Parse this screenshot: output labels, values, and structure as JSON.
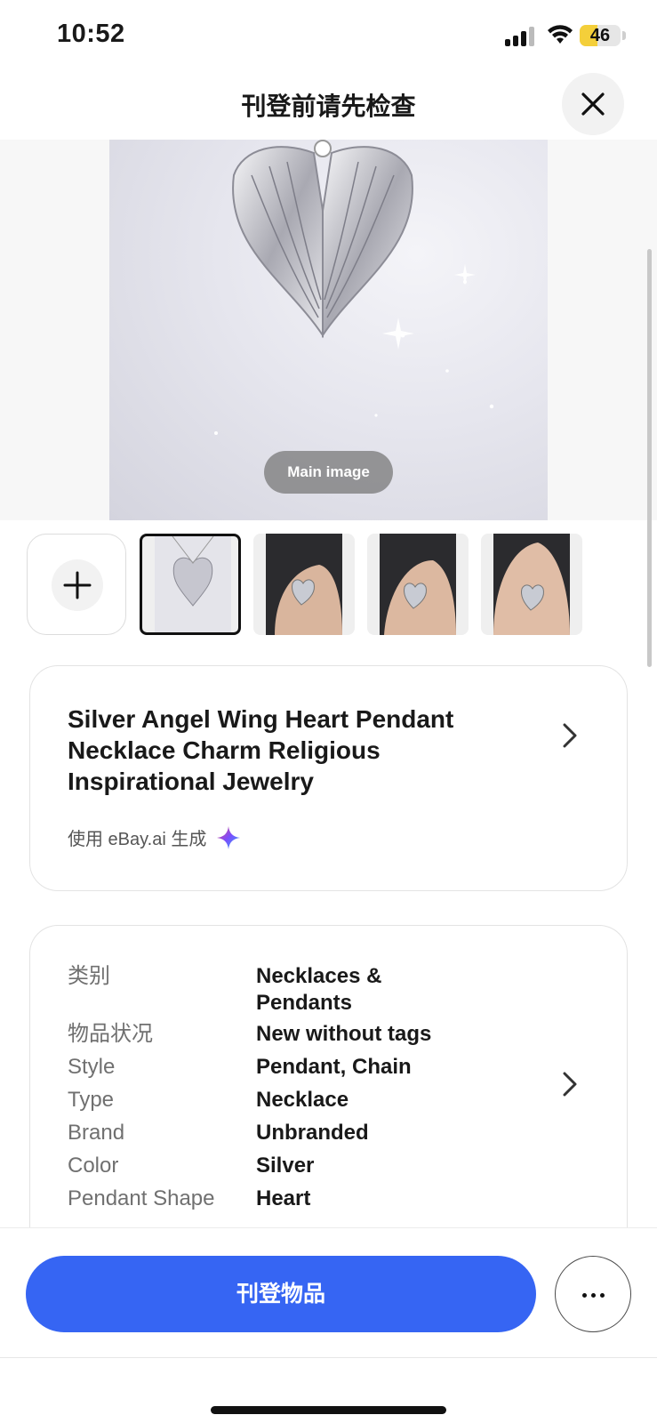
{
  "status_bar": {
    "time": "10:52",
    "battery": "46"
  },
  "header": {
    "title": "刊登前请先检查"
  },
  "main_image": {
    "badge": "Main image"
  },
  "listing": {
    "title": "Silver Angel Wing Heart Pendant Necklace Charm Religious Inspirational Jewelry",
    "ai_label": "使用 eBay.ai 生成"
  },
  "details": [
    {
      "key": "类别",
      "value": "Necklaces & Pendants"
    },
    {
      "key": "物品状况",
      "value": "New without tags"
    },
    {
      "key": "Style",
      "value": "Pendant, Chain"
    },
    {
      "key": "Type",
      "value": "Necklace"
    },
    {
      "key": "Brand",
      "value": "Unbranded"
    },
    {
      "key": "Color",
      "value": "Silver"
    },
    {
      "key": "Pendant Shape",
      "value": "Heart"
    }
  ],
  "actions": {
    "primary": "刊登物品"
  },
  "colors": {
    "primary": "#3665f3",
    "text": "#191919",
    "muted": "#707070"
  }
}
